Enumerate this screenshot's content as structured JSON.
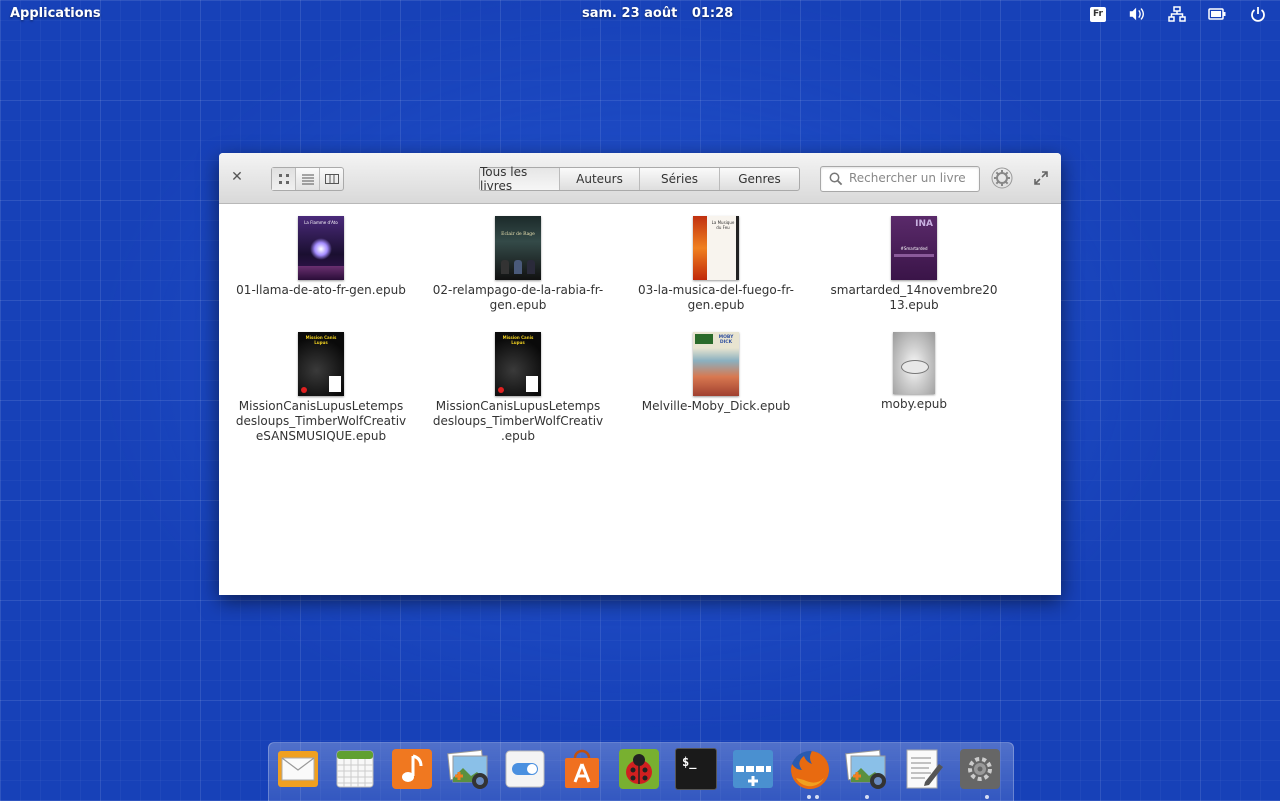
{
  "panel": {
    "applications_label": "Applications",
    "date": "sam. 23 août",
    "time": "01:28",
    "keyboard_layout": "Fr"
  },
  "window": {
    "close_glyph": "✕",
    "tabs": [
      {
        "label": "Tous les livres",
        "active": true
      },
      {
        "label": "Auteurs",
        "active": false
      },
      {
        "label": "Séries",
        "active": false
      },
      {
        "label": "Genres",
        "active": false
      }
    ],
    "search_placeholder": "Rechercher un livre",
    "books": [
      {
        "name": "01-llama-de-ato-fr-gen.epub"
      },
      {
        "name": "02-relampago-de-la-rabia-fr-gen.epub"
      },
      {
        "name": "03-la-musica-del-fuego-fr-gen.epub"
      },
      {
        "name": "smartarded_14novembre2013.epub"
      },
      {
        "name": "MissionCanisLupusLetempsdesloups_TimberWolfCreativeSANSMUSIQUE.epub"
      },
      {
        "name": "MissionCanisLupusLetempsdesloups_TimberWolfCreativ.epub"
      },
      {
        "name": "Melville-Moby_Dick.epub"
      },
      {
        "name": "moby.epub"
      }
    ],
    "cover_texts": {
      "c1": "La Flamme d'Ato",
      "c2": "Eclair de Rage",
      "c3": "La Musique du Feu",
      "c4": "#Smartarded",
      "c5": "Mission Canis Lupus",
      "c6": "Mission Canis Lupus",
      "c7": "MOBY DICK"
    }
  },
  "dock": {
    "items": [
      "mail-app",
      "calendar-app",
      "music-app",
      "photos-app",
      "switchboard-app",
      "app-center",
      "bug-tracker-app",
      "terminal-app",
      "workspaces-app",
      "firefox-app",
      "photos-app-2",
      "text-editor-app",
      "settings-app"
    ],
    "terminal_label": "$_"
  }
}
